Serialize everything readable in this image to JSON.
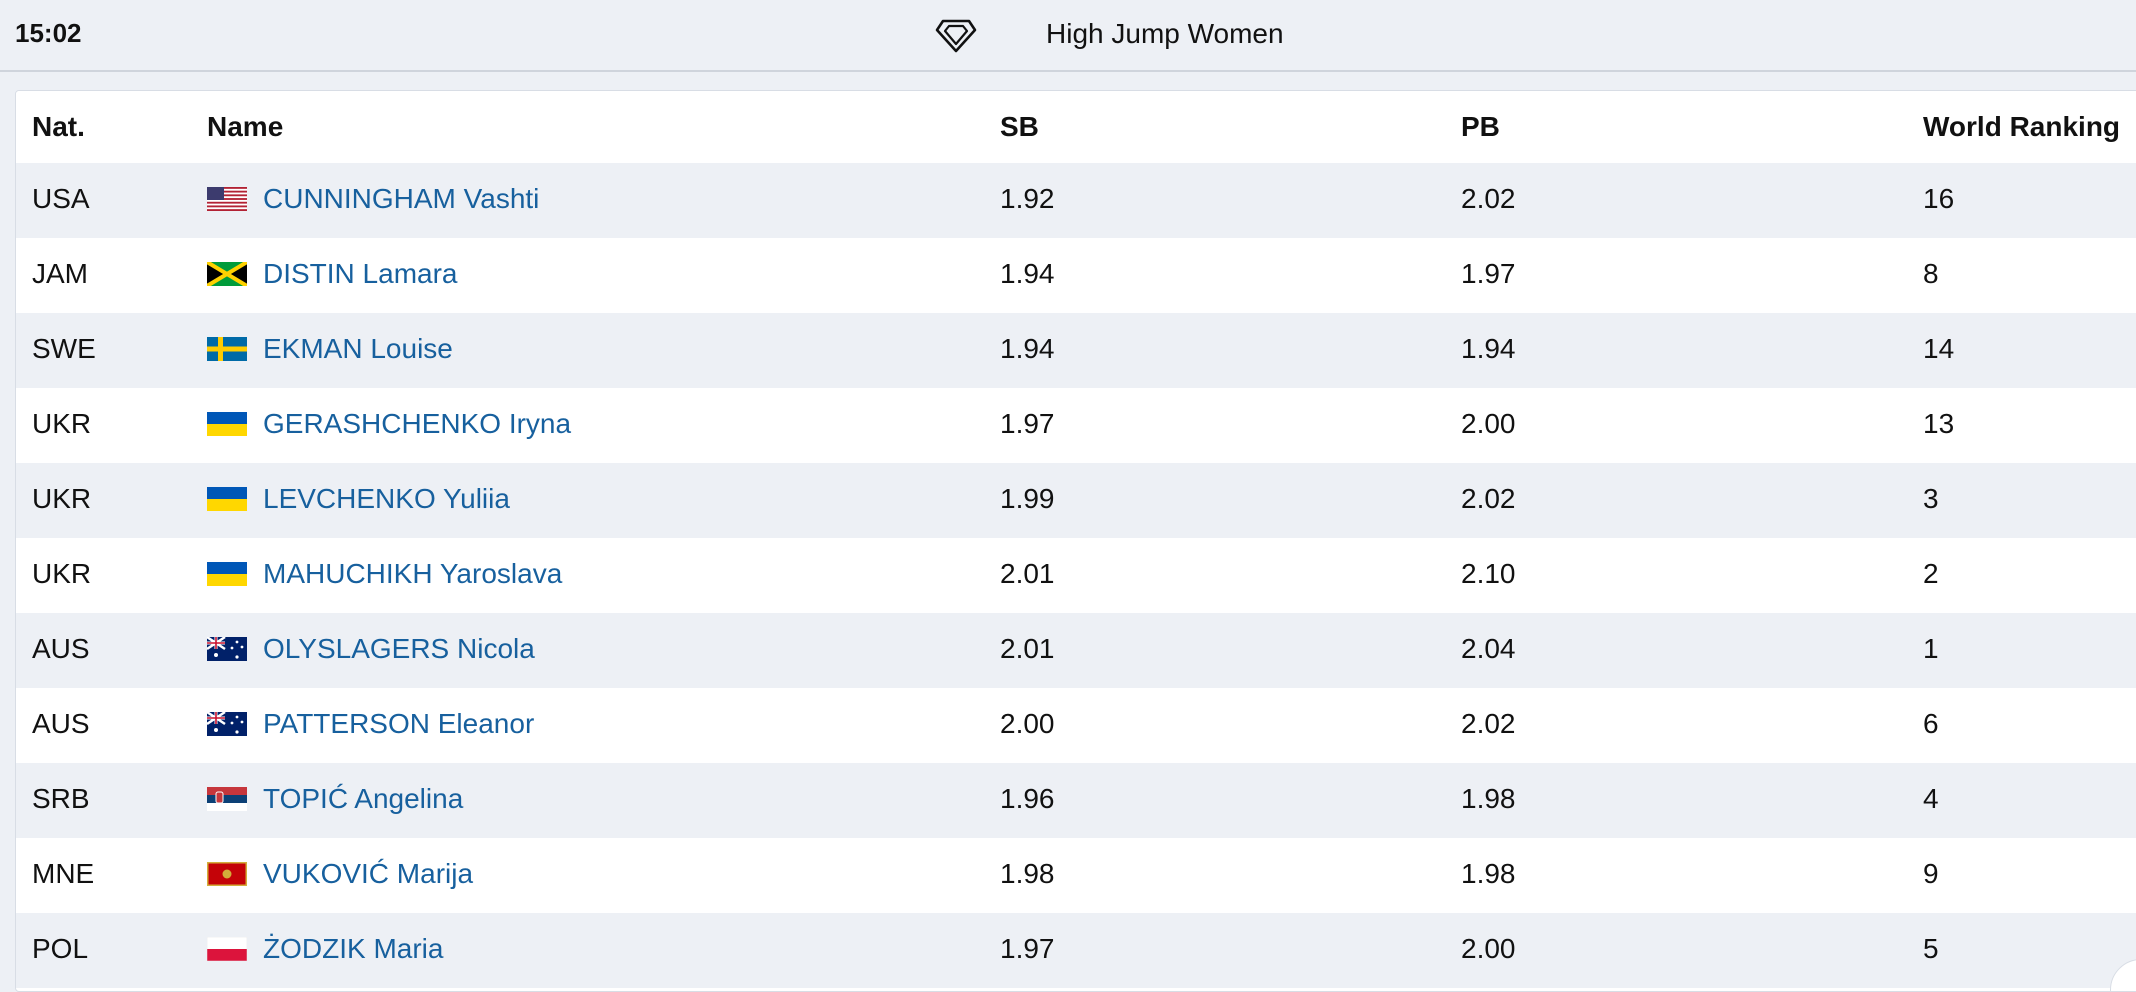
{
  "header": {
    "time": "15:02",
    "event_title": "High Jump Women",
    "icon": "diamond-league-icon"
  },
  "table": {
    "columns": {
      "nat": "Nat.",
      "name": "Name",
      "sb": "SB",
      "pb": "PB",
      "world_ranking": "World Ranking"
    },
    "rows": [
      {
        "nat": "USA",
        "flag": "usa-flag-icon",
        "name": "CUNNINGHAM Vashti",
        "sb": "1.92",
        "pb": "2.02",
        "wr": "16"
      },
      {
        "nat": "JAM",
        "flag": "jamaica-flag-icon",
        "name": "DISTIN Lamara",
        "sb": "1.94",
        "pb": "1.97",
        "wr": "8"
      },
      {
        "nat": "SWE",
        "flag": "sweden-flag-icon",
        "name": "EKMAN Louise",
        "sb": "1.94",
        "pb": "1.94",
        "wr": "14"
      },
      {
        "nat": "UKR",
        "flag": "ukraine-flag-icon",
        "name": "GERASHCHENKO Iryna",
        "sb": "1.97",
        "pb": "2.00",
        "wr": "13"
      },
      {
        "nat": "UKR",
        "flag": "ukraine-flag-icon",
        "name": "LEVCHENKO Yuliia",
        "sb": "1.99",
        "pb": "2.02",
        "wr": "3"
      },
      {
        "nat": "UKR",
        "flag": "ukraine-flag-icon",
        "name": "MAHUCHIKH Yaroslava",
        "sb": "2.01",
        "pb": "2.10",
        "wr": "2"
      },
      {
        "nat": "AUS",
        "flag": "australia-flag-icon",
        "name": "OLYSLAGERS Nicola",
        "sb": "2.01",
        "pb": "2.04",
        "wr": "1"
      },
      {
        "nat": "AUS",
        "flag": "australia-flag-icon",
        "name": "PATTERSON Eleanor",
        "sb": "2.00",
        "pb": "2.02",
        "wr": "6"
      },
      {
        "nat": "SRB",
        "flag": "serbia-flag-icon",
        "name": "TOPIĆ Angelina",
        "sb": "1.96",
        "pb": "1.98",
        "wr": "4"
      },
      {
        "nat": "MNE",
        "flag": "montenegro-flag-icon",
        "name": "VUKOVIĆ Marija",
        "sb": "1.98",
        "pb": "1.98",
        "wr": "9"
      },
      {
        "nat": "POL",
        "flag": "poland-flag-icon",
        "name": "ŻODZIK Maria",
        "sb": "1.97",
        "pb": "2.00",
        "wr": "5"
      }
    ]
  },
  "colors": {
    "link": "#17609e",
    "stripe": "#edf0f5",
    "background": "#edf0f5"
  }
}
